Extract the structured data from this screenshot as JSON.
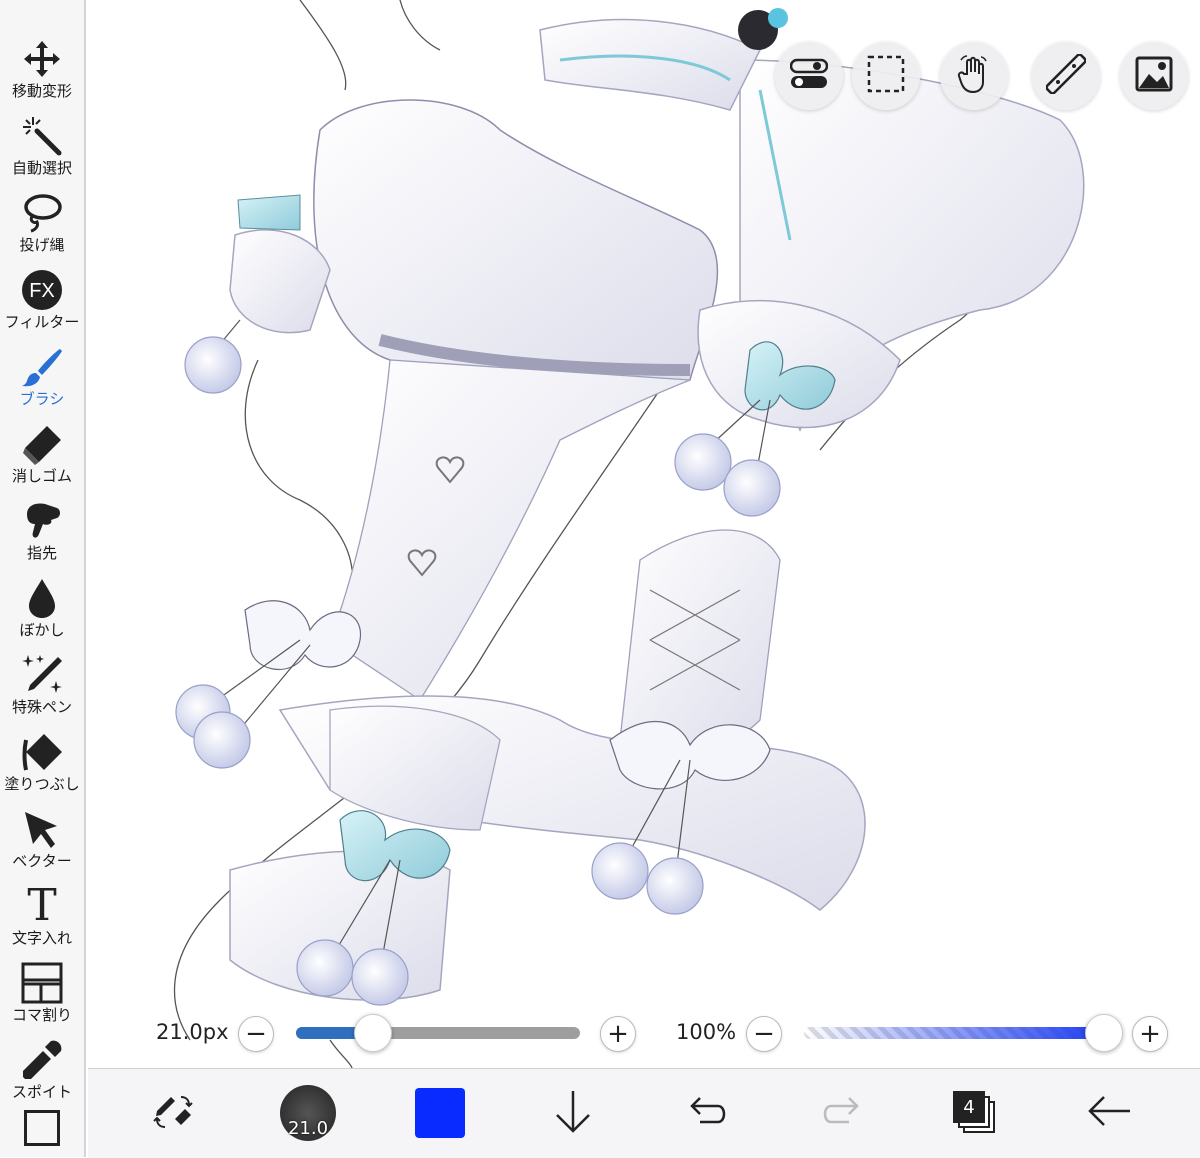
{
  "toolbar": {
    "tools": [
      {
        "label": "移動変形",
        "icon": "move-icon"
      },
      {
        "label": "自動選択",
        "icon": "magic-wand-icon"
      },
      {
        "label": "投げ縄",
        "icon": "lasso-icon"
      },
      {
        "label": "フィルター",
        "icon": "fx-icon",
        "badge": "FX"
      },
      {
        "label": "ブラシ",
        "icon": "brush-icon",
        "active": true
      },
      {
        "label": "消しゴム",
        "icon": "eraser-icon"
      },
      {
        "label": "指先",
        "icon": "finger-icon"
      },
      {
        "label": "ぼかし",
        "icon": "blur-drop-icon"
      },
      {
        "label": "特殊ペン",
        "icon": "special-pen-icon"
      },
      {
        "label": "塗りつぶし",
        "icon": "fill-bucket-icon"
      },
      {
        "label": "ベクター",
        "icon": "vector-arrow-icon"
      },
      {
        "label": "文字入れ",
        "icon": "text-icon",
        "glyph": "T"
      },
      {
        "label": "コマ割り",
        "icon": "frame-divider-icon"
      },
      {
        "label": "スポイト",
        "icon": "eyedropper-icon"
      }
    ],
    "active_color": "#2a6fd6"
  },
  "top_buttons": [
    "toggle-icon",
    "selection-icon",
    "hand-icon",
    "ruler-icon",
    "image-icon"
  ],
  "brush_size": {
    "label": "21.0px",
    "value": 21.0,
    "fraction": 0.27
  },
  "opacity": {
    "label": "100%",
    "value": 100,
    "fraction": 1.0
  },
  "bottom_bar": {
    "brush_preview_value": "21.0",
    "current_color": "#0a2bff",
    "layers_count": "4"
  },
  "colors": {
    "slider_fill": "#2f6fbf",
    "slider_track": "#9e9e9e",
    "opacity_fill": "#1e3df0"
  }
}
